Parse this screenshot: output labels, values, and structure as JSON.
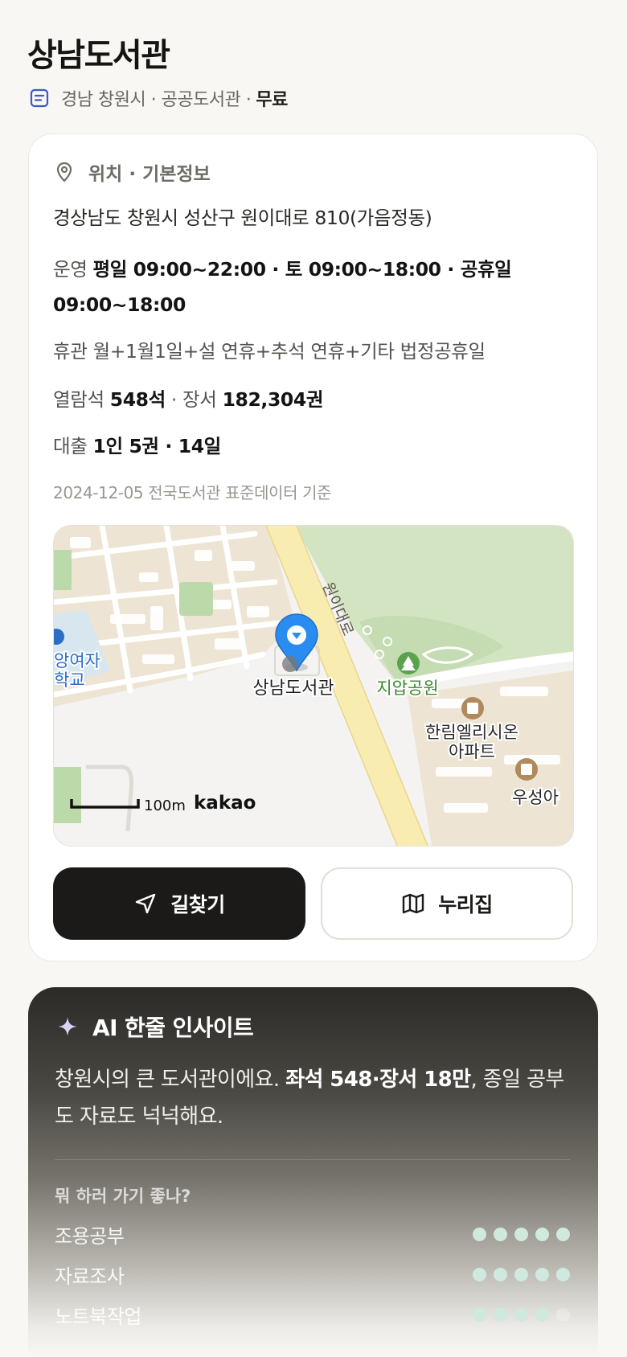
{
  "header": {
    "title": "상남도서관",
    "subtitle": "경남 창원시 · 공공도서관 ·",
    "fee": "무료"
  },
  "info": {
    "section_label": "위치 · 기본정보",
    "address": "경상남도 창원시 성산구 원이대로 810(가음정동)",
    "hours_label": "운영",
    "hours_value": "평일 09:00~22:00 · 토 09:00~18:00 · 공휴일 09:00~18:00",
    "closed_label": "휴관",
    "closed_value": "월+1월1일+설 연휴+추석 연휴+기타 법정공휴일",
    "seats_label": "열람석",
    "seats_value": "548석",
    "books_label": "· 장서",
    "books_value": "182,304권",
    "loan_label": "대출",
    "loan_value": "1인 5권 · 14일",
    "source": "2024-12-05 전국도서관 표준데이터 기준"
  },
  "map": {
    "road_label": "원이대로",
    "marker_label": "상남도서관",
    "park_label": "지압공원",
    "apt_label_1": "한림엘리시온",
    "apt_label_2": "아파트",
    "apt_label_3": "우성아",
    "school_label_1": "앙여자",
    "school_label_2": "학교",
    "scale_label": "100m",
    "brand": "kakao",
    "colors": {
      "road": "#f9ecb0",
      "park": "#d3e4c3",
      "block": "#ede4d3",
      "pin": "#2a8cf0"
    }
  },
  "buttons": {
    "directions": "길찾기",
    "website": "누리집"
  },
  "ai": {
    "title": "AI 한줄 인사이트",
    "text_1": "창원시의 큰 도서관이에요.",
    "text_bold": "좌석 548·장서 18만",
    "text_2": ", 종일 공부도 자료도 넉넉해요.",
    "subtitle": "뭐 하러 가기 좋나?",
    "rows": [
      {
        "label": "조용공부",
        "score": 5
      },
      {
        "label": "자료조사",
        "score": 5
      },
      {
        "label": "노트북작업",
        "score": 4
      }
    ]
  }
}
